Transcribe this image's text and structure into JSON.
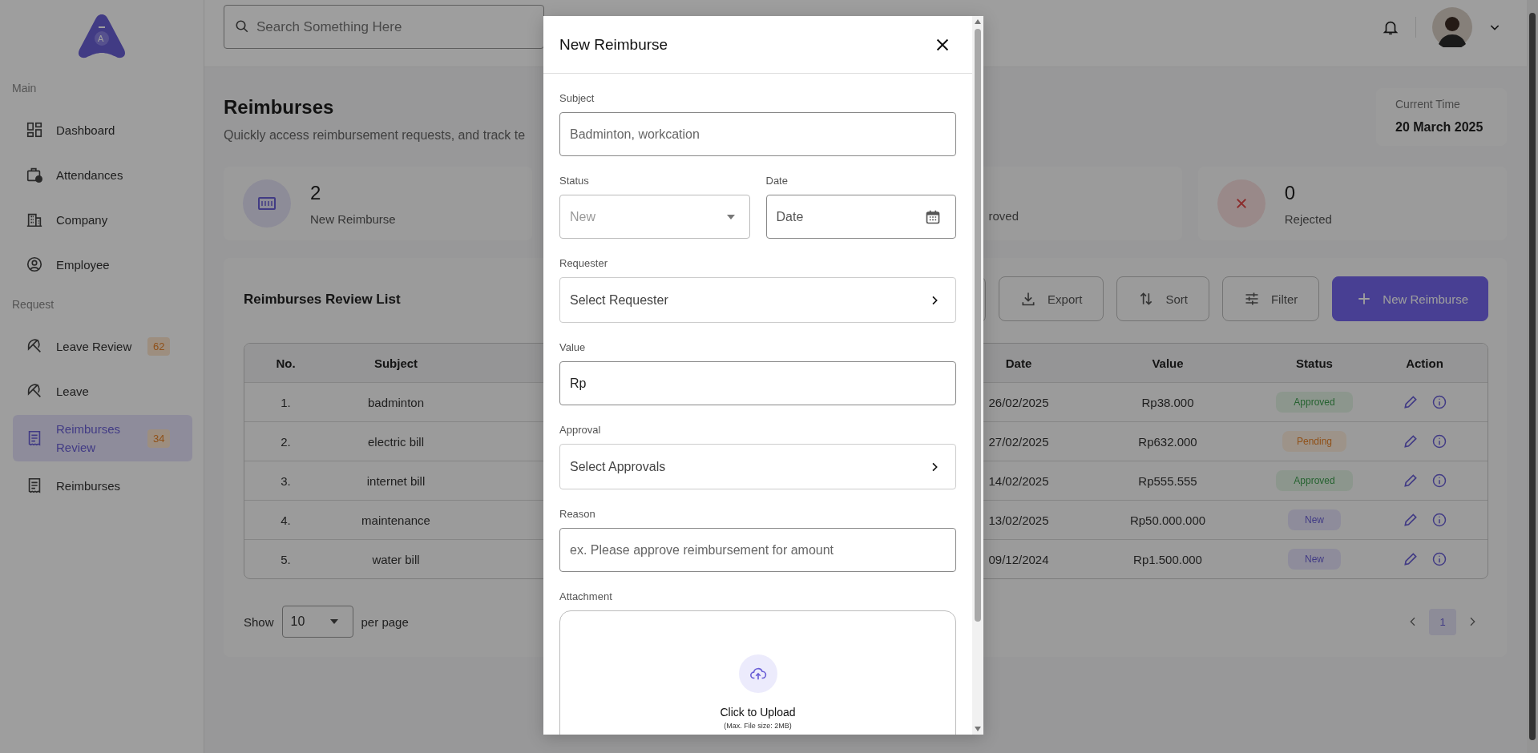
{
  "sidebar": {
    "logo": {
      "letter": "A"
    },
    "sections": [
      {
        "title": "Main",
        "items": [
          {
            "label": "Dashboard",
            "selected": false
          },
          {
            "label": "Attendances",
            "selected": false
          },
          {
            "label": "Company",
            "selected": false
          },
          {
            "label": "Employee",
            "selected": false
          }
        ]
      },
      {
        "title": "Request",
        "items": [
          {
            "label": "Leave Review",
            "badge": "62",
            "selected": false
          },
          {
            "label": "Leave",
            "selected": false
          },
          {
            "label": "Reimburses Review",
            "badge": "34",
            "selected": true
          },
          {
            "label": "Reimburses",
            "selected": false
          }
        ]
      }
    ]
  },
  "header": {
    "search": {
      "placeholder": "Search Something Here"
    }
  },
  "page": {
    "title": "Reimburses",
    "subtitle": "Quickly access reimbursement requests, and track te",
    "current_time": {
      "label": "Current Time",
      "value": "20 March 2025"
    }
  },
  "stats": [
    {
      "kind": "new",
      "count": "2",
      "label": "New Reimburse"
    },
    {
      "kind": "partial",
      "label": "roved"
    },
    {
      "kind": "rejected",
      "count": "0",
      "label": "Rejected"
    }
  ],
  "list": {
    "title": "Reimburses Review List",
    "buttons": [
      {
        "kind": "export",
        "label": "Export"
      },
      {
        "kind": "sort",
        "label": "Sort"
      },
      {
        "kind": "filter",
        "label": "Filter"
      },
      {
        "kind": "primary",
        "label": "New Reimburse"
      }
    ],
    "columns": [
      "No.",
      "Subject",
      "Date",
      "Value",
      "Status",
      "Action"
    ],
    "rows": [
      {
        "no": "1.",
        "subject": "badminton",
        "date": "26/02/2025",
        "value": "Rp38.000",
        "status": "Approved",
        "kind": "approved"
      },
      {
        "no": "2.",
        "subject": "electric bill",
        "date": "27/02/2025",
        "value": "Rp632.000",
        "status": "Pending",
        "kind": "pending"
      },
      {
        "no": "3.",
        "subject": "internet bill",
        "date": "14/02/2025",
        "value": "Rp555.555",
        "status": "Approved",
        "kind": "approved"
      },
      {
        "no": "4.",
        "subject": "maintenance",
        "date": "13/02/2025",
        "value": "Rp50.000.000",
        "status": "New",
        "kind": "new"
      },
      {
        "no": "5.",
        "subject": "water bill",
        "date": "09/12/2024",
        "value": "Rp1.500.000",
        "status": "New",
        "kind": "new"
      }
    ],
    "pagination": {
      "show_label": "Show",
      "page_size": "10",
      "per_page_label": "per page",
      "pages": [
        {
          "label": "1",
          "selected": true
        }
      ]
    }
  },
  "modal": {
    "title": "New Reimburse",
    "fields": [
      {
        "kind": "text",
        "label": "Subject",
        "placeholder": "Badminton, workcation"
      },
      {
        "kind": "select",
        "label": "Status",
        "value": "New",
        "disabled": true
      },
      {
        "kind": "date",
        "label": "Date",
        "placeholder": "Date"
      },
      {
        "kind": "picker",
        "label": "Requester",
        "value": "Select Requester"
      },
      {
        "kind": "text",
        "label": "Value",
        "value": "Rp"
      },
      {
        "kind": "picker",
        "label": "Approval",
        "value": "Select Approvals"
      },
      {
        "kind": "text",
        "label": "Reason",
        "placeholder": "ex. Please approve reimbursement for amount"
      },
      {
        "kind": "upload",
        "label": "Attachment",
        "title": "Click to Upload",
        "hint": "(Max. File size: 2MB)"
      }
    ]
  }
}
